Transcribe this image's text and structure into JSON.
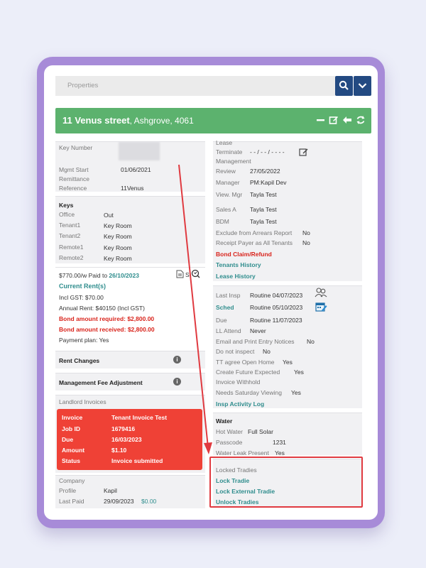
{
  "search": {
    "placeholder": "Properties"
  },
  "title": {
    "street": "11 Venus street",
    "suburb": ", Ashgrove, 4061"
  },
  "left_top": {
    "key_number_label": "Key Number",
    "mgmt_start_label": "Mgmt Start",
    "mgmt_start_value": "01/06/2021",
    "remittance_label": "Remittance",
    "reference_label": "Reference",
    "reference_value": "11Venus"
  },
  "keys": {
    "title": "Keys",
    "rows": [
      {
        "label": "Office",
        "value": "Out"
      },
      {
        "label": "Tenant1",
        "value": "Key Room"
      },
      {
        "label": "Tenant2",
        "value": "Key Room"
      },
      {
        "label": "Remote1",
        "value": "Key Room"
      },
      {
        "label": "Remote2",
        "value": "Key Room"
      }
    ]
  },
  "rent": {
    "paid_prefix": "$770.00/w Paid to ",
    "paid_date": "26/10/2023",
    "current_label": "Current Rent(s)",
    "incl_gst": "Incl GST: $70.00",
    "annual": "Annual Rent: $40150 (Incl GST)",
    "bond_required": "Bond amount required: $2,800.00",
    "bond_received": "Bond amount received: $2,800.00",
    "payment_plan": "Payment plan: Yes",
    "s_letter": "S"
  },
  "rent_changes": "Rent Changes",
  "mgmt_fee": "Management Fee Adjustment",
  "landlord_invoices": {
    "title": "Landlord Invoices",
    "rows": [
      {
        "label": "Invoice",
        "value": "Tenant Invoice Test"
      },
      {
        "label": "Job ID",
        "value": "1679416"
      },
      {
        "label": "Due",
        "value": "16/03/2023"
      },
      {
        "label": "Amount",
        "value": "$1.10"
      },
      {
        "label": "Status",
        "value": "Invoice submitted"
      }
    ]
  },
  "company": {
    "title": "Company",
    "profile_label": "Profile",
    "profile_value": "Kapil",
    "last_paid_label": "Last Paid",
    "last_paid_value": "29/09/2023",
    "last_paid_amount": "$0.00"
  },
  "lease": {
    "lease_label": "Lease",
    "terminate_label": "Terminate",
    "terminate_value": "- - / - - / - - - -",
    "management_label": "Management",
    "review_label": "Review",
    "review_value": "27/05/2022",
    "manager_label": "Manager",
    "manager_value": "PM:Kapil Dev",
    "view_mgr_label": "View. Mgr",
    "view_mgr_value": "Tayla Test",
    "sales_a_label": "Sales A",
    "sales_a_value": "Tayla Test",
    "bdm_label": "BDM",
    "bdm_value": "Tayla Test",
    "exclude_label": "Exclude from Arrears Report",
    "exclude_value": "No",
    "receipt_label": "Receipt Payer as All Tenants",
    "receipt_value": "No",
    "bond_claim": "Bond Claim/Refund",
    "tenants_history": "Tenants History",
    "lease_history": "Lease History"
  },
  "inspection": {
    "last_label": "Last Insp",
    "last_value": "Routine 04/07/2023",
    "sched_label": "Sched",
    "sched_value": "Routine 05/10/2023",
    "due_label": "Due",
    "due_value": "Routine 11/07/2023",
    "ll_label": "LL Attend",
    "ll_value": "Never",
    "email_label": "Email and Print Entry Notices",
    "email_value": "No",
    "dni_label": "Do not inspect",
    "dni_value": "No",
    "tt_label": "TT agree Open Home",
    "tt_value": "Yes",
    "cfe_label": "Create Future Expected",
    "cfe_value": "Yes",
    "iw_label": "Invoice Withhold",
    "nsv_label": "Needs Saturday Viewing",
    "nsv_value": "Yes",
    "activity_log": "Insp Activity Log"
  },
  "water": {
    "title": "Water",
    "hot_label": "Hot Water",
    "hot_value": "Full Solar",
    "pass_label": "Passcode",
    "pass_value": "1231",
    "leak_label": "Water Leak Present",
    "leak_value": "Yes"
  },
  "tradies": {
    "title": "Locked Tradies",
    "lock": "Lock Tradie",
    "lock_external": "Lock External Tradie",
    "unlock": "Unlock Tradies"
  },
  "colors": {
    "green": "#5cb26e",
    "navy": "#234a82",
    "red": "#ef4136",
    "teal": "#2f8d8d",
    "frame": "#a78bd8"
  }
}
